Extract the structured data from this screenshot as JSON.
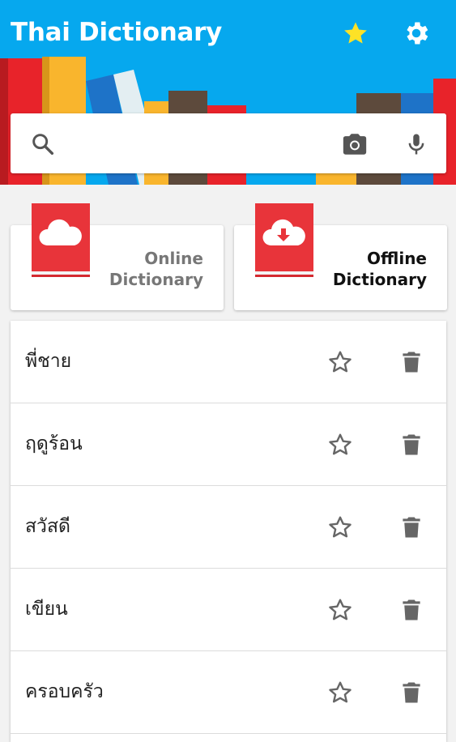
{
  "app": {
    "title": "Thai Dictionary",
    "accent": "#06a8ee",
    "book_color": "#e8343a"
  },
  "header": {
    "favorites_icon": "star-icon",
    "settings_icon": "gear-icon"
  },
  "search": {
    "value": "",
    "placeholder": "",
    "icons": [
      "search-icon",
      "camera-icon",
      "microphone-icon"
    ]
  },
  "dictionaries": [
    {
      "line1": "Online",
      "line2": "Dictionary",
      "icon": "cloud-icon",
      "color": "#777777"
    },
    {
      "line1": "Offline",
      "line2": "Dictionary",
      "icon": "cloud-download-icon",
      "color": "#111111"
    }
  ],
  "history": [
    {
      "word": "พี่ชาย"
    },
    {
      "word": "ฤดูร้อน"
    },
    {
      "word": "สวัสดี"
    },
    {
      "word": "เขียน"
    },
    {
      "word": "ครอบครัว"
    }
  ]
}
